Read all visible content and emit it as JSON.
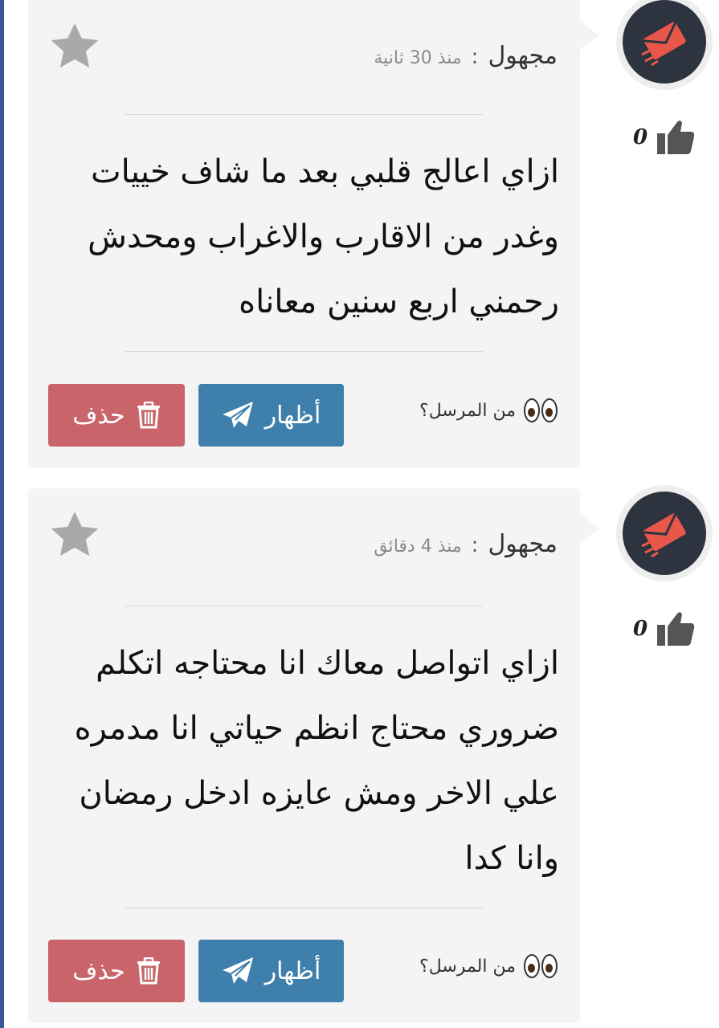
{
  "messages": [
    {
      "author": "مجهول",
      "separator": ":",
      "time": "منذ 30 ثانية",
      "text": "ازاي اعالج قلبي بعد ما شاف خييات وغدر من الاقارب والاغراب ومحدش رحمني اربع سنين معاناه",
      "who_label": "من المرسل؟",
      "show_label": "أظهار",
      "delete_label": "حذف",
      "likes": "0"
    },
    {
      "author": "مجهول",
      "separator": ":",
      "time": "منذ 4 دقائق",
      "text": "ازاي اتواصل معاك انا محتاجه اتكلم ضروري محتاج انظم حياتي انا مدمره علي الاخر ومش عايزه ادخل رمضان وانا كدا",
      "who_label": "من المرسل؟",
      "show_label": "أظهار",
      "delete_label": "حذف",
      "likes": "0"
    }
  ],
  "colors": {
    "card_bg": "#f4f4f4",
    "show_button": "#3e7fab",
    "delete_button": "#c9646a",
    "avatar_bg": "#2d3440",
    "avatar_icon": "#e9574a",
    "star": "#a9a9a9",
    "edge": "#3b5998"
  },
  "icons": [
    "star-icon",
    "paper-plane-icon",
    "trash-icon",
    "eyes-icon",
    "envelope-icon",
    "thumbs-up-icon"
  ]
}
